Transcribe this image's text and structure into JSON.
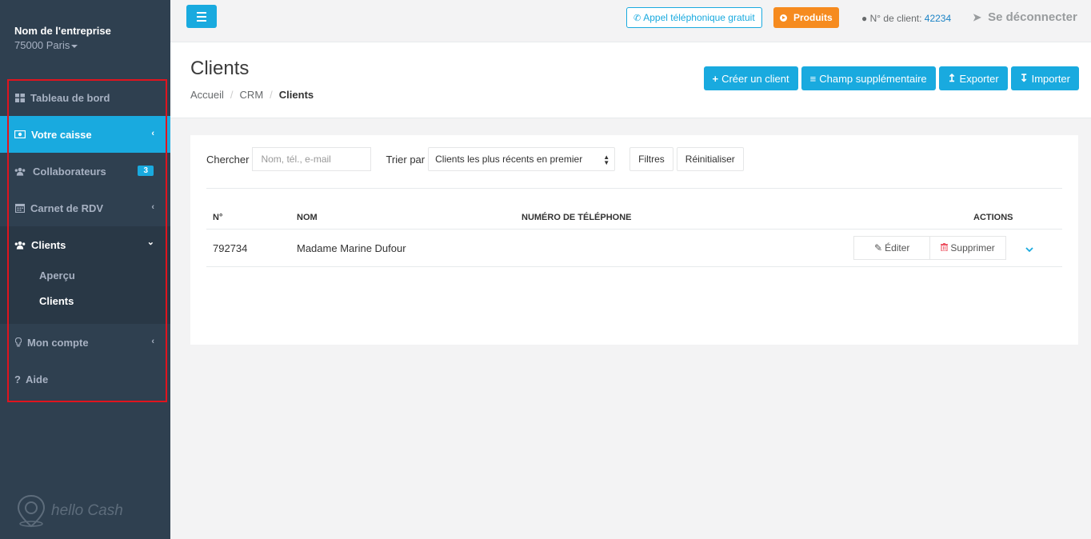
{
  "sidebar": {
    "company_name": "Nom de l'entreprise",
    "company_city": "75000 Paris",
    "items": [
      {
        "label": "Tableau de bord",
        "icon": "dashboard-icon"
      },
      {
        "label": "Votre caisse",
        "icon": "cash-register-icon"
      },
      {
        "label": "Collaborateurs",
        "icon": "users-icon",
        "badge": "3"
      },
      {
        "label": "Carnet de RDV",
        "icon": "calendar-icon"
      },
      {
        "label": "Clients",
        "icon": "clients-icon",
        "sub": [
          "Aperçu",
          "Clients"
        ]
      },
      {
        "label": "Mon compte",
        "icon": "lightbulb-icon"
      },
      {
        "label": "Aide",
        "icon": "question-icon"
      }
    ],
    "logo_text": "hello Cash"
  },
  "topbar": {
    "call_label": "Appel téléphonique gratuit",
    "products_label": "Produits",
    "client_no_label": "N° de client:",
    "client_no": "42234",
    "logout_label": "Se déconnecter"
  },
  "heading": {
    "title": "Clients",
    "breadcrumb": [
      "Accueil",
      "CRM",
      "Clients"
    ],
    "buttons": [
      "Créer un client",
      "Champ supplémentaire",
      "Exporter",
      "Importer"
    ]
  },
  "filters": {
    "search_label": "Chercher",
    "search_placeholder": "Nom, tél., e-mail",
    "sort_label": "Trier par",
    "sort_value": "Clients les plus récents en premier",
    "filters_button": "Filtres",
    "reset_button": "Réinitialiser"
  },
  "table": {
    "headers": [
      "N°",
      "NOM",
      "NUMÉRO DE TÉLÉPHONE",
      "ACTIONS"
    ],
    "rows": [
      {
        "no": "792734",
        "name": "Madame Marine Dufour",
        "phone": ""
      }
    ],
    "edit_label": "Éditer",
    "delete_label": "Supprimer"
  },
  "colors": {
    "sidebar_bg": "#2f4050",
    "accent": "#19aadf",
    "products": "#f68b1f",
    "highlight": "#e0141e"
  }
}
